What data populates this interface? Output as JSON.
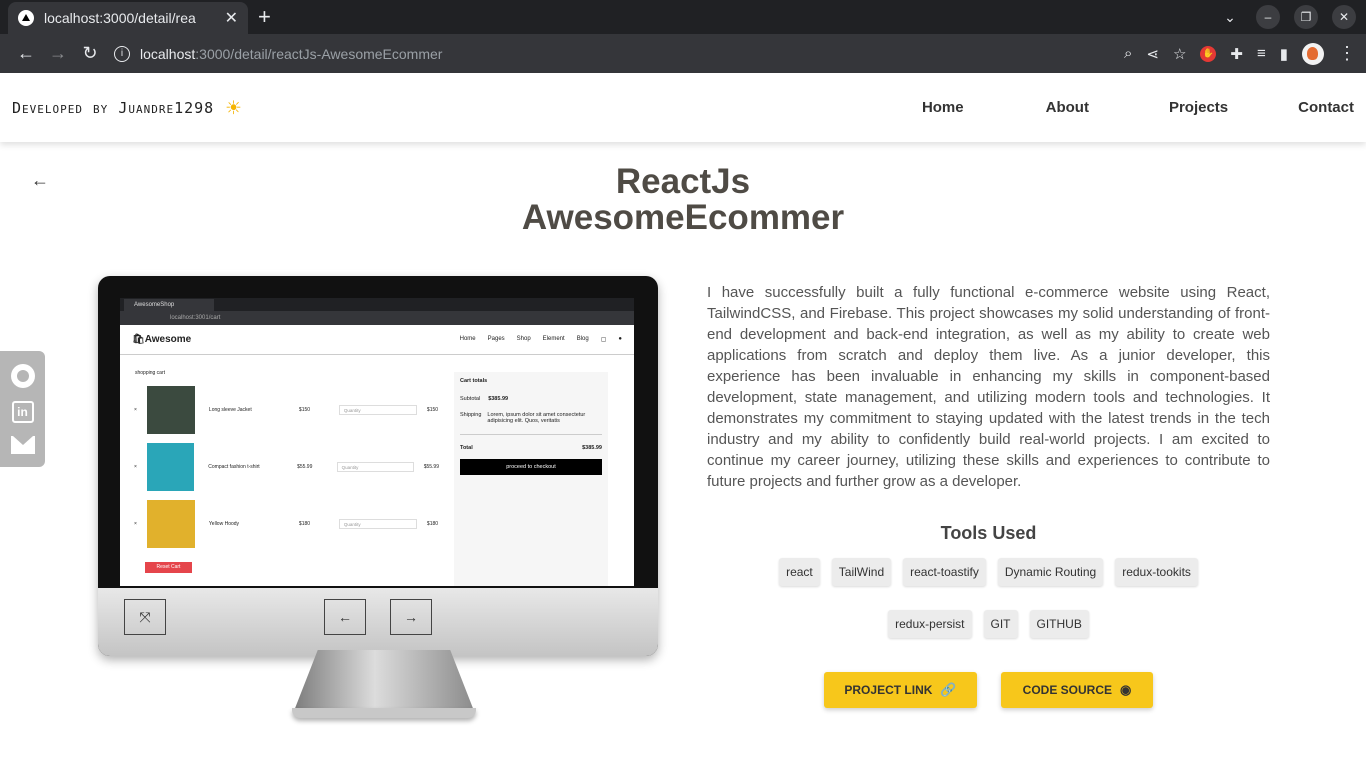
{
  "browser": {
    "tab_title": "localhost:3000/detail/rea",
    "url_host": "localhost",
    "url_path": ":3000/detail/reactJs-AwesomeEcommer"
  },
  "header": {
    "brand": "Developed by Juandre1298",
    "nav": [
      "Home",
      "About",
      "Projects",
      "Contact"
    ]
  },
  "project": {
    "title_line1": "ReactJs",
    "title_line2": "AwesomeEcommer",
    "description": "I have successfully built a fully functional e-commerce website using React, TailwindCSS, and Firebase. This project showcases my solid understanding of front-end development and back-end integration, as well as my ability to create web applications from scratch and deploy them live. As a junior developer, this experience has been invaluable in enhancing my skills in component-based development, state management, and utilizing modern tools and technologies. It demonstrates my commitment to staying updated with the latest trends in the tech industry and my ability to confidently build real-world projects. I am excited to continue my career journey, utilizing these skills and experiences to contribute to future projects and further grow as a developer.",
    "tools_title": "Tools Used",
    "tools_row1": [
      "react",
      "TailWind",
      "react-toastify",
      "Dynamic Routing",
      "redux-tookits"
    ],
    "tools_row2": [
      "redux-persist",
      "GIT",
      "GITHUB"
    ],
    "project_link_label": "PROJECT LINK",
    "code_source_label": "CODE SOURCE"
  },
  "preview": {
    "tab": "AwesomeShop",
    "url": "localhost:3001/cart",
    "logo": "Awesome",
    "nav": [
      "Home",
      "Pages",
      "Shop",
      "Element",
      "Blog"
    ],
    "heading": "shopping cart",
    "items": [
      {
        "name": "Long sleeve Jacket",
        "price": "$150",
        "total": "$150",
        "color": "#3b4a3f"
      },
      {
        "name": "Compact fashion t-shirt",
        "price": "$55.99",
        "total": "$55.99",
        "color": "#2aa6b8"
      },
      {
        "name": "Yellow Hoody",
        "price": "$180",
        "total": "$180",
        "color": "#e1b12c"
      }
    ],
    "quantity_label": "Quantity",
    "reset_label": "Reset Cart",
    "totals_title": "Cart totals",
    "subtotal_label": "Subtotal",
    "subtotal_value": "$385.99",
    "shipping_label": "Shipping",
    "shipping_text": "Lorem, ipsum dolor sit amet consectetur adipisicing elit. Quos, veritatis",
    "total_label": "Total",
    "total_value": "$385.99",
    "checkout_label": "proceed to checkout"
  }
}
